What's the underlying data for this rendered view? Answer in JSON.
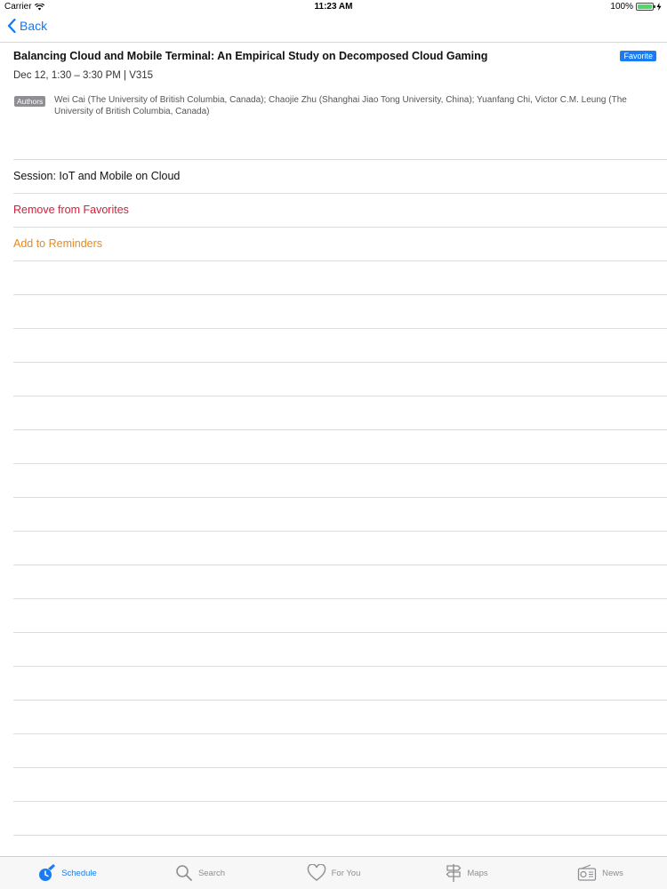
{
  "status_bar": {
    "carrier": "Carrier",
    "time": "11:23 AM",
    "battery": "100%",
    "battery_level": 1.0
  },
  "nav": {
    "back_label": "Back"
  },
  "talk": {
    "title": "Balancing Cloud and Mobile Terminal: An Empirical Study on Decomposed Cloud Gaming",
    "favorite_badge": "Favorite",
    "time_location": "Dec 12, 1:30 – 3:30 PM | V315",
    "authors_tag": "Authors",
    "authors": "Wei Cai (The University of British Columbia, Canada); Chaojie Zhu (Shanghai Jiao Tong University, China); Yuanfang Chi, Victor C.M. Leung (The University of British Columbia, Canada)"
  },
  "rows": {
    "session": "Session: IoT and Mobile on Cloud",
    "remove_favorites": "Remove from Favorites",
    "add_reminders": "Add to Reminders"
  },
  "colors": {
    "accent": "#1a7cf0",
    "remove": "#d0213a",
    "reminder": "#e8891b"
  },
  "tabs": [
    {
      "label": "Schedule",
      "icon": "schedule-icon",
      "active": true
    },
    {
      "label": "Search",
      "icon": "search-icon",
      "active": false
    },
    {
      "label": "For You",
      "icon": "heart-icon",
      "active": false
    },
    {
      "label": "Maps",
      "icon": "signpost-icon",
      "active": false
    },
    {
      "label": "News",
      "icon": "radio-icon",
      "active": false
    }
  ]
}
